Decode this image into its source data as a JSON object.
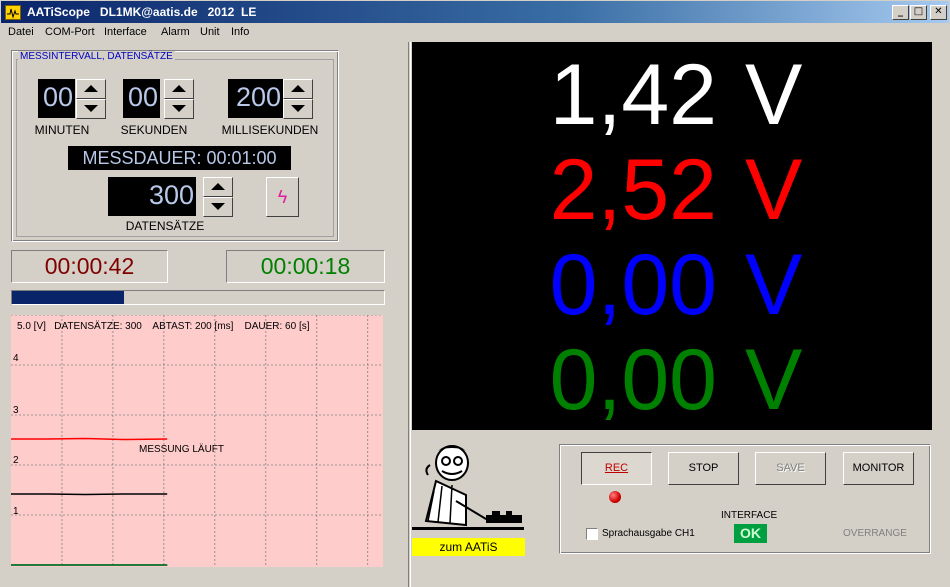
{
  "window": {
    "title": "AATiScope   DL1MK@aatis.de   2012  LE",
    "minimize": "_",
    "maximize": "□",
    "close": "✕"
  },
  "menu": [
    "Datei",
    "COM-Port",
    "Interface",
    "Alarm",
    "Unit",
    "Info"
  ],
  "settings": {
    "group_title": "MESSINTERVALL, DATENSÄTZE",
    "minutes": "00",
    "minutes_label": "MINUTEN",
    "seconds": "00",
    "seconds_label": "SEKUNDEN",
    "milliseconds": "200",
    "milliseconds_label": "MILLISEKUNDEN",
    "messdauer": "MESSDAUER: 00:01:00",
    "datasets": "300",
    "datasets_label": "DATENSÄTZE",
    "bolt_icon": "lightning-icon"
  },
  "timers": {
    "elapsed": "00:00:42",
    "elapsed_color": "#800000",
    "remaining": "00:00:18",
    "remaining_color": "#008000"
  },
  "progress": {
    "value": 0.3
  },
  "plot": {
    "header": "5.0 [V]   DATENSÄTZE: 300    ABTAST: 200 [ms]    DAUER: 60 [s]",
    "status": "MESSUNG LÄUFT",
    "y_labels": [
      "4",
      "3",
      "2",
      "1"
    ],
    "background": "#ffcccc"
  },
  "chart_data": {
    "type": "line",
    "xlim": [
      0,
      300
    ],
    "ylim": [
      0,
      5
    ],
    "series": [
      {
        "color": "#ff0000",
        "x": [
          0,
          30,
          60,
          90,
          126
        ],
        "y": [
          2.52,
          2.52,
          2.53,
          2.51,
          2.52
        ]
      },
      {
        "color": "#000000",
        "x": [
          0,
          30,
          60,
          90,
          126
        ],
        "y": [
          1.42,
          1.42,
          1.41,
          1.42,
          1.42
        ]
      },
      {
        "color": "#0000ff",
        "x": [
          0,
          126
        ],
        "y": [
          0.0,
          0.0
        ]
      },
      {
        "color": "#008000",
        "x": [
          0,
          126
        ],
        "y": [
          0.0,
          0.0
        ]
      }
    ]
  },
  "readings": [
    {
      "value": "1,42",
      "unit": "V",
      "color": "#ffffff"
    },
    {
      "value": "2,52",
      "unit": "V",
      "color": "#ff0000"
    },
    {
      "value": "0,00",
      "unit": "V",
      "color": "#0000ff"
    },
    {
      "value": "0,00",
      "unit": "V",
      "color": "#008000"
    }
  ],
  "controls": {
    "rec": "REC",
    "stop": "STOP",
    "save": "SAVE",
    "monitor": "MONITOR",
    "speech_checkbox": "Sprachausgabe CH1",
    "interface_label": "INTERFACE",
    "interface_status": "OK",
    "overrange": "OVERRANGE",
    "aatis_link": "zum  AATiS"
  }
}
